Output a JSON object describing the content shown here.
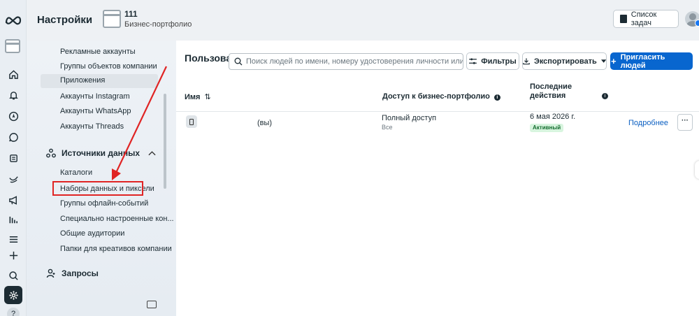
{
  "header": {
    "title": "Настройки",
    "business_name": "111",
    "business_subtitle": "Бизнес-портфолио",
    "tasks_label": "Список задач"
  },
  "rail": {
    "icons": [
      "meta-logo",
      "portfolio-icon",
      "home-icon",
      "bell-icon",
      "compass-icon",
      "chat-icon",
      "catalog-icon",
      "ads-icon",
      "megaphone-icon",
      "chart-icon",
      "menu-icon",
      "plus-icon",
      "search-icon",
      "settings-icon",
      "help-icon"
    ],
    "help_label": "?"
  },
  "settings_nav": {
    "items_top": [
      {
        "label": "Рекламные аккаунты"
      },
      {
        "label": "Группы объектов компании"
      },
      {
        "label": "Приложения",
        "selected": true
      },
      {
        "label": "Аккаунты Instagram"
      },
      {
        "label": "Аккаунты WhatsApp"
      },
      {
        "label": "Аккаунты Threads"
      }
    ],
    "section_data_sources": "Источники данных",
    "data_source_items": [
      {
        "label": "Каталоги"
      },
      {
        "label": "Наборы данных и пиксели",
        "highlighted": true
      },
      {
        "label": "Группы офлайн-событий"
      },
      {
        "label": "Специально настроенные кон..."
      },
      {
        "label": "Общие аудитории"
      },
      {
        "label": "Папки для креативов компании"
      }
    ],
    "section_requests": "Запросы"
  },
  "main": {
    "page_title": "Пользователи",
    "search_placeholder": "Поиск людей по имени, номеру удостоверения личности или электрон",
    "filters_label": "Фильтры",
    "export_label": "Экспортировать",
    "invite_label": "Пригласить людей",
    "columns": {
      "name": "Имя",
      "access": "Доступ к бизнес-портфолио",
      "last_activity_1": "Последние",
      "last_activity_2": "действия"
    },
    "rows": [
      {
        "name": "(вы)",
        "access": "Полный доступ",
        "access_sub": "Все",
        "date": "6 мая 2026 г.",
        "status": "Активный",
        "details": "Подробнее",
        "more": "···"
      }
    ]
  },
  "colors": {
    "accent": "#0866cf",
    "annotation": "#e02424",
    "status_bg": "#d8f5df"
  }
}
